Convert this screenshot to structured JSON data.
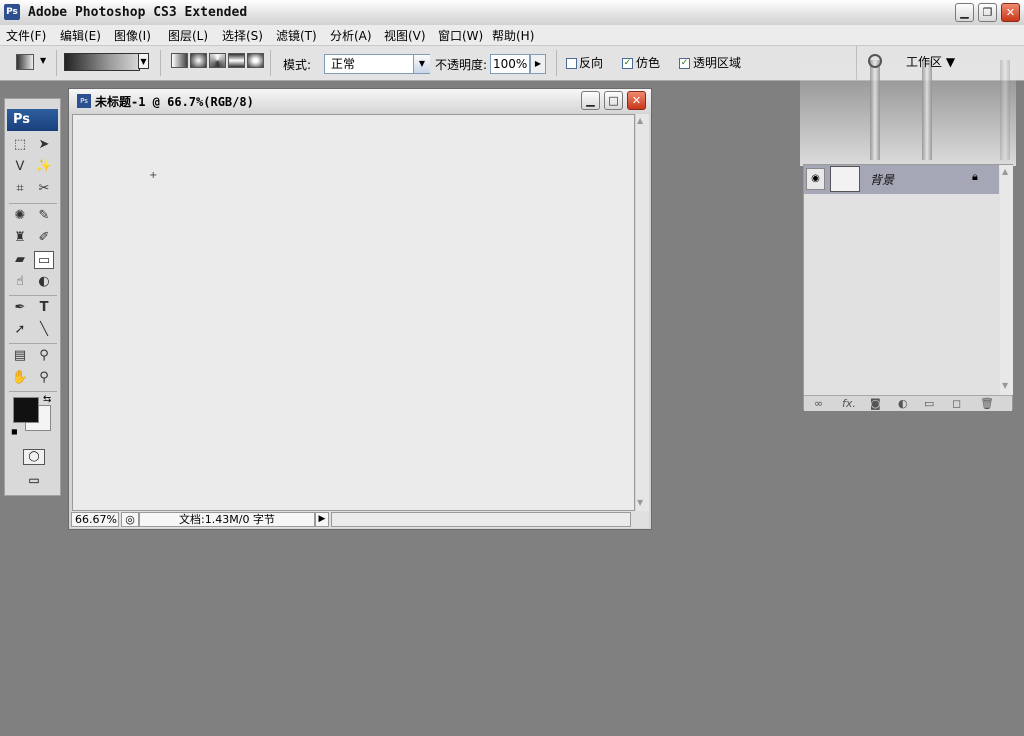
{
  "window": {
    "title": "Adobe Photoshop CS3 Extended",
    "app_icon": "Ps",
    "controls": {
      "minimize": "▁",
      "restore": "❐",
      "close": "✕"
    }
  },
  "menu": {
    "items": [
      "文件(F)",
      "编辑(E)",
      "图像(I)",
      "图层(L)",
      "选择(S)",
      "滤镜(T)",
      "分析(A)",
      "视图(V)",
      "窗口(W)",
      "帮助(H)"
    ]
  },
  "options_bar": {
    "mode_label": "模式:",
    "mode_value": "正常",
    "opacity_label": "不透明度:",
    "opacity_value": "100%",
    "reverse_label": "反向",
    "reverse_checked": false,
    "dither_label": "仿色",
    "dither_checked": true,
    "transparency_label": "透明区域",
    "transparency_checked": true
  },
  "toolbox": {
    "logo": "Ps",
    "tools": [
      "rect-marquee",
      "move",
      "lasso",
      "magic-wand",
      "crop",
      "slice",
      "healing-brush",
      "brush",
      "clone-stamp",
      "history-brush",
      "eraser",
      "gradient",
      "blur",
      "dodge",
      "pen",
      "type",
      "path-select",
      "line",
      "notes",
      "eyedropper",
      "hand",
      "zoom"
    ],
    "selected_tool": "gradient",
    "foreground_color": "#111111",
    "background_color": "#f4f4f4"
  },
  "document": {
    "title": "未标题-1 @ 66.7%(RGB/8)",
    "zoom": "66.67%",
    "doc_info": "文档:1.43M/0 字节"
  },
  "workspace": {
    "label": "工作区 ▼"
  },
  "layers": {
    "items": [
      {
        "name": "背景",
        "visible": true,
        "locked": true
      }
    ],
    "footer_icons": [
      "link-icon",
      "fx-icon",
      "mask-icon",
      "adjustment-icon",
      "group-icon",
      "new-layer-icon",
      "trash-icon"
    ]
  }
}
